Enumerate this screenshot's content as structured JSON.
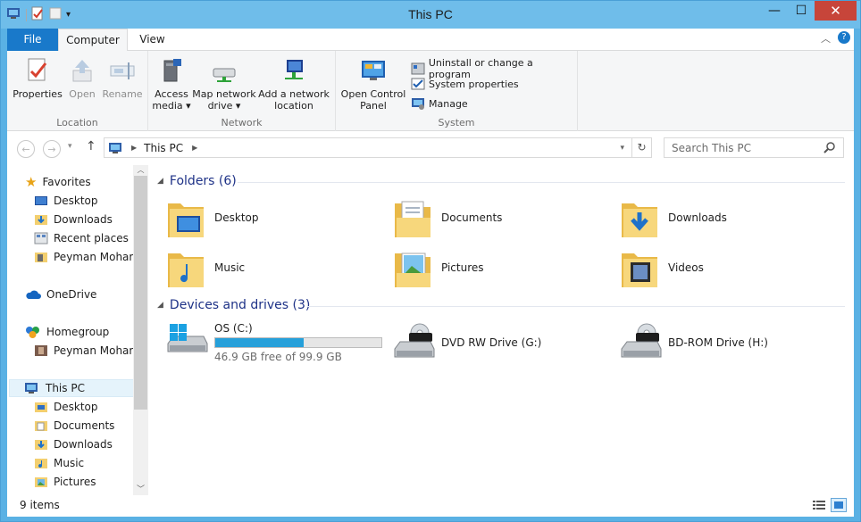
{
  "window": {
    "title": "This PC"
  },
  "ribbon": {
    "tabs": {
      "file": "File",
      "computer": "Computer",
      "view": "View"
    },
    "location": {
      "label": "Location",
      "properties": "Properties",
      "open": "Open",
      "rename": "Rename"
    },
    "network": {
      "label": "Network",
      "access_media_line1": "Access",
      "access_media_line2": "media ▾",
      "map_drive_line1": "Map network",
      "map_drive_line2": "drive ▾",
      "add_location_line1": "Add a network",
      "add_location_line2": "location"
    },
    "system": {
      "label": "System",
      "control_panel_line1": "Open Control",
      "control_panel_line2": "Panel",
      "uninstall": "Uninstall or change a program",
      "system_properties": "System properties",
      "manage": "Manage"
    }
  },
  "address": {
    "path": "This PC",
    "search_placeholder": "Search This PC"
  },
  "navpane": {
    "favorites": "Favorites",
    "fav_items": [
      "Desktop",
      "Downloads",
      "Recent places",
      "Peyman Moham"
    ],
    "onedrive": "OneDrive",
    "homegroup": "Homegroup",
    "homegroup_items": [
      "Peyman Moham"
    ],
    "thispc": "This PC",
    "thispc_items": [
      "Desktop",
      "Documents",
      "Downloads",
      "Music",
      "Pictures"
    ]
  },
  "folders": {
    "header": "Folders (6)",
    "items": [
      "Desktop",
      "Documents",
      "Downloads",
      "Music",
      "Pictures",
      "Videos"
    ]
  },
  "drives": {
    "header": "Devices and drives (3)",
    "os_name": "OS (C:)",
    "os_free": "46.9 GB free of 99.9 GB",
    "os_used_fraction": 0.53,
    "dvd_name": "DVD RW Drive (G:)",
    "bd_name": "BD-ROM Drive (H:)"
  },
  "status": {
    "items": "9 items"
  },
  "colors": {
    "accent": "#1979ca",
    "progress": "#26a0da",
    "folder": "#f3cf6f",
    "header_text": "#1e3287"
  }
}
